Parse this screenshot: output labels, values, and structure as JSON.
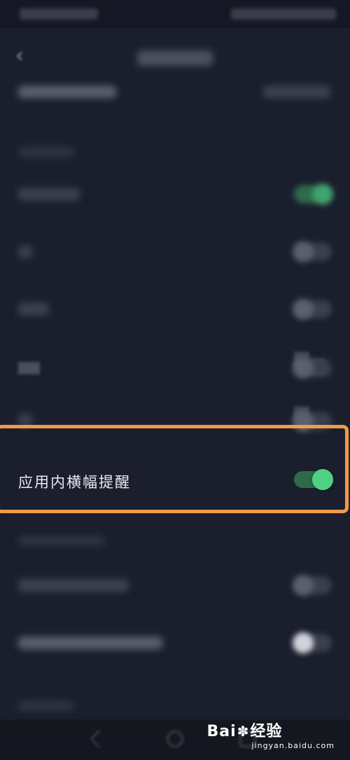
{
  "setting_row": {
    "label": "应用内横幅提醒",
    "enabled": true,
    "accent_color": "#4ed183",
    "highlight_color": "#f09a4a"
  },
  "watermark": {
    "main_left": "Bai",
    "main_right": "经验",
    "sub": "jingyan.baidu.com"
  },
  "icons": {
    "back": "chevron-left-icon",
    "nav_back": "nav-back-icon",
    "nav_home": "nav-home-icon",
    "nav_recent": "nav-recent-icon",
    "paw": "paw-icon"
  }
}
